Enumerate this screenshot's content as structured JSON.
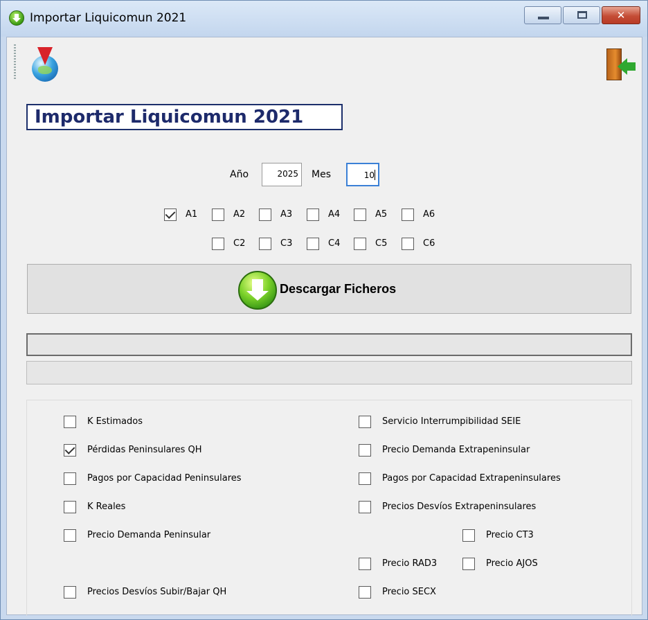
{
  "window": {
    "title": "Importar Liquicomun 2021",
    "close_glyph": "✕"
  },
  "header": {
    "title": "Importar Liquicomun 2021"
  },
  "period": {
    "year_label": "Año",
    "year_value": "2025",
    "month_label": "Mes",
    "month_value": "10"
  },
  "files": [
    {
      "label": "A1",
      "checked": true
    },
    {
      "label": "A2",
      "checked": false
    },
    {
      "label": "A3",
      "checked": false
    },
    {
      "label": "A4",
      "checked": false
    },
    {
      "label": "A5",
      "checked": false
    },
    {
      "label": "A6",
      "checked": false
    },
    {
      "label": "C2",
      "checked": false
    },
    {
      "label": "C3",
      "checked": false
    },
    {
      "label": "C4",
      "checked": false
    },
    {
      "label": "C5",
      "checked": false
    },
    {
      "label": "C6",
      "checked": false
    }
  ],
  "download_button": {
    "label": "Descargar Ficheros",
    "icon": "download-arrow-icon"
  },
  "progress": {
    "primary": 0,
    "secondary": 0
  },
  "options": [
    {
      "label": "K Estimados",
      "checked": false
    },
    {
      "label": "Pérdidas Peninsulares QH",
      "checked": true
    },
    {
      "label": "Pagos por Capacidad Peninsulares",
      "checked": false
    },
    {
      "label": "K Reales",
      "checked": false
    },
    {
      "label": "Precio Demanda Peninsular",
      "checked": false
    },
    {
      "label": "Precios Desvíos Subir/Bajar QH",
      "checked": false
    },
    {
      "label": "Servicio Interrumpibilidad SEIE",
      "checked": false
    },
    {
      "label": "Precio Demanda Extrapeninsular",
      "checked": false
    },
    {
      "label": "Pagos por Capacidad Extrapeninsulares",
      "checked": false
    },
    {
      "label": "Precios Desvíos Extrapeninsulares",
      "checked": false
    },
    {
      "label": "Precio CT3",
      "checked": false
    },
    {
      "label": "Precio RAD3",
      "checked": false
    },
    {
      "label": "Precio AJOS",
      "checked": false
    },
    {
      "label": "Precio SECX",
      "checked": false
    }
  ],
  "toolbar": {
    "globe_icon": "globe-pin-icon",
    "exit_icon": "exit-door-icon"
  }
}
